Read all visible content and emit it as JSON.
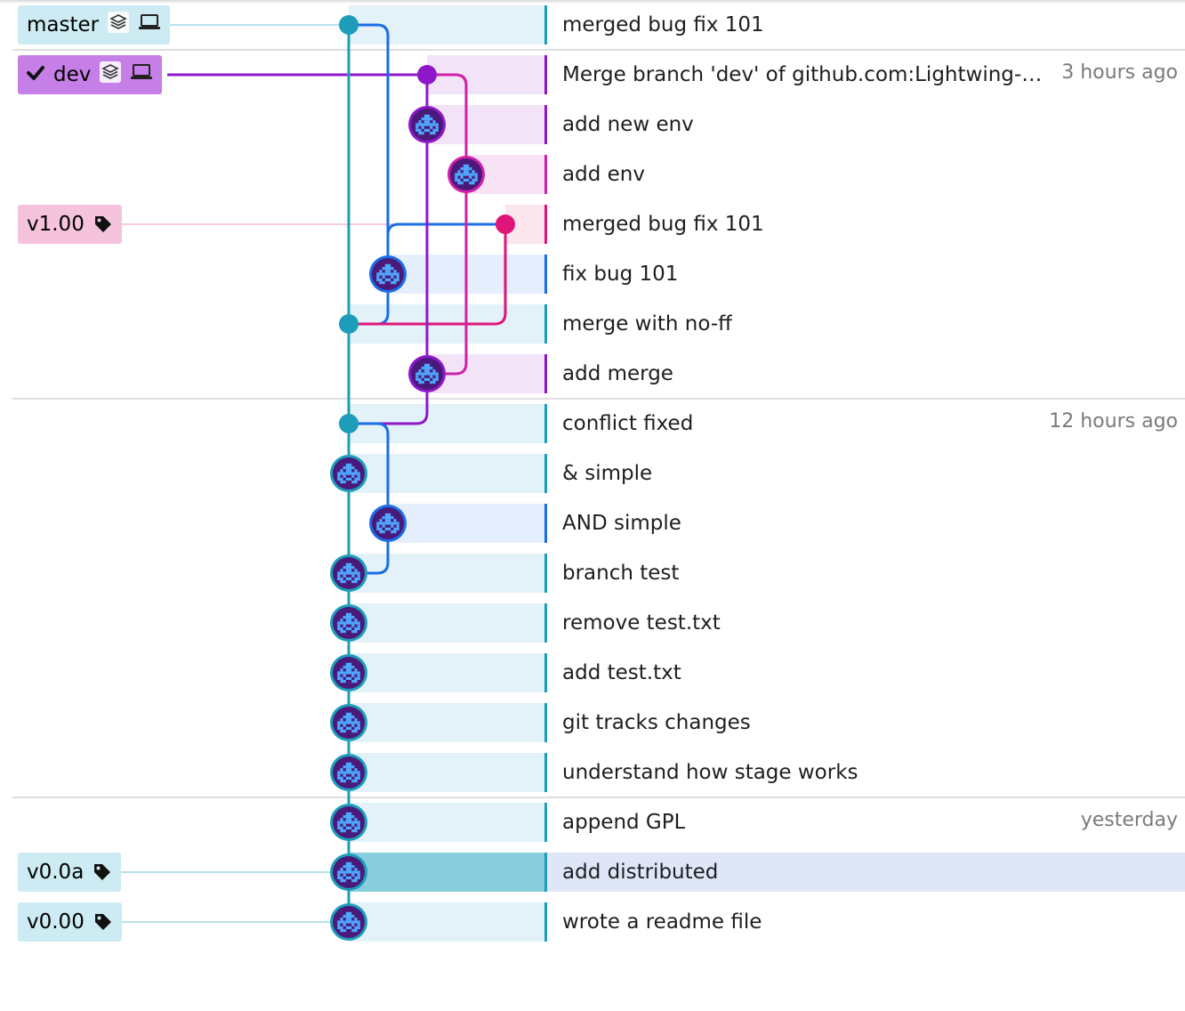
{
  "colors": {
    "teal": "#1d9db9",
    "blue": "#1a6ee6",
    "purple": "#8e18c9",
    "magenta": "#d01fa8",
    "pink": "#e0157a",
    "teal_bg": "#e3f2f8",
    "blue_bg": "#e5eefc",
    "purple_bg": "#f2e3f8",
    "magenta_bg": "#f7e3f3",
    "pink_bg": "#fce6ee",
    "selected_graph_bg": "#89cedd",
    "selected_msg_bg": "#dfe6f8",
    "master_badge_bg": "#cdebf2",
    "dev_badge_bg": "#c67fe6",
    "v1_badge_bg": "#f6c3dc",
    "tag_badge_bg": "#cdebf2"
  },
  "branches": {
    "master": {
      "label": "master",
      "icons": [
        "stack-icon",
        "laptop-icon"
      ]
    },
    "dev": {
      "label": "dev",
      "checked": true,
      "icons": [
        "stack-icon",
        "laptop-icon"
      ]
    }
  },
  "tags": {
    "v1": {
      "label": "v1.00",
      "icon": "tag-icon"
    },
    "v0a": {
      "label": "v0.0a",
      "icon": "tag-icon"
    },
    "v0": {
      "label": "v0.00",
      "icon": "tag-icon"
    }
  },
  "commits": [
    {
      "message": "merged bug fix 101",
      "time": "",
      "lane": "teal",
      "node": "dot",
      "selected": false
    },
    {
      "message": "Merge branch 'dev' of github.com:Lightwing-Ng/learngit",
      "time": "3 hours ago",
      "lane": "purple",
      "node": "dot",
      "selected": false
    },
    {
      "message": "add new env",
      "time": "",
      "lane": "purple",
      "node": "avatar",
      "selected": false
    },
    {
      "message": "add env",
      "time": "",
      "lane": "magenta",
      "node": "avatar",
      "selected": false
    },
    {
      "message": "merged bug fix 101",
      "time": "",
      "lane": "pink",
      "node": "dot",
      "selected": false
    },
    {
      "message": "fix bug 101",
      "time": "",
      "lane": "blue",
      "node": "avatar",
      "selected": false
    },
    {
      "message": "merge with no-ff",
      "time": "",
      "lane": "teal",
      "node": "dot",
      "selected": false
    },
    {
      "message": "add merge",
      "time": "",
      "lane": "purple",
      "node": "avatar",
      "selected": false
    },
    {
      "message": "conflict fixed",
      "time": "12 hours ago",
      "lane": "teal",
      "node": "dot",
      "selected": false
    },
    {
      "message": "& simple",
      "time": "",
      "lane": "teal",
      "node": "avatar",
      "selected": false
    },
    {
      "message": "AND simple",
      "time": "",
      "lane": "blue",
      "node": "avatar",
      "selected": false
    },
    {
      "message": "branch test",
      "time": "",
      "lane": "teal",
      "node": "avatar",
      "selected": false
    },
    {
      "message": "remove test.txt",
      "time": "",
      "lane": "teal",
      "node": "avatar",
      "selected": false
    },
    {
      "message": "add test.txt",
      "time": "",
      "lane": "teal",
      "node": "avatar",
      "selected": false
    },
    {
      "message": "git tracks changes",
      "time": "",
      "lane": "teal",
      "node": "avatar",
      "selected": false
    },
    {
      "message": "understand how stage works",
      "time": "",
      "lane": "teal",
      "node": "avatar",
      "selected": false
    },
    {
      "message": "append GPL",
      "time": "yesterday",
      "lane": "teal",
      "node": "avatar",
      "selected": false
    },
    {
      "message": "add distributed",
      "time": "",
      "lane": "teal",
      "node": "avatar",
      "selected": true
    },
    {
      "message": "wrote a readme file",
      "time": "",
      "lane": "teal",
      "node": "avatar",
      "selected": false
    }
  ]
}
